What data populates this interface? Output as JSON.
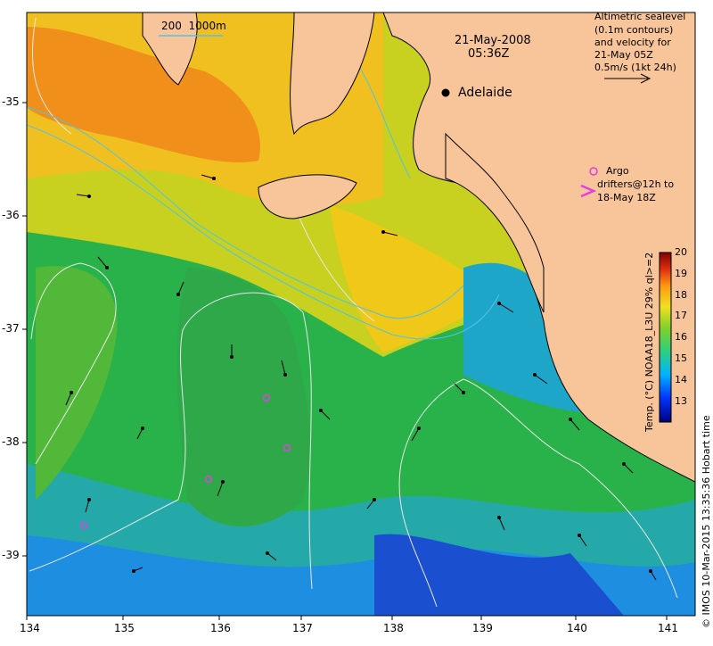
{
  "map": {
    "date": "21-May-2008",
    "time": "05:36Z",
    "city": "Adelaide",
    "scale_label": "200  1000m",
    "legend_title_lines": [
      "Altimetric sealevel",
      "(0.1m contours)",
      "and velocity for",
      "21-May 05Z",
      "0.5m/s (1kt 24h)"
    ],
    "argo_lines": [
      "Argo",
      "drifters@12h to",
      "18-May 18Z"
    ],
    "lon_ticks": [
      "134",
      "135",
      "136",
      "137",
      "138",
      "139",
      "140",
      "141"
    ],
    "lat_ticks": [
      "-35",
      "-36",
      "-37",
      "-38",
      "-39"
    ],
    "colorbar": {
      "ticks": [
        "20",
        "19",
        "18",
        "17",
        "16",
        "15",
        "14",
        "13"
      ],
      "label": "Temp. (°C) NOAA18_L3U 29% ql>=2"
    },
    "credit": "© IMOS 10-Mar-2015 13:35:36 Hobart time",
    "colors": {
      "land": "#f8c49a",
      "cold": "#1f3fbf",
      "cool": "#1fa0d8",
      "mid": "#22b548",
      "warm": "#f0d018",
      "hot": "#f08a18",
      "contour": "#e8e8e8",
      "isobath": "#4fc3e8",
      "argo": "#e040e0"
    }
  }
}
